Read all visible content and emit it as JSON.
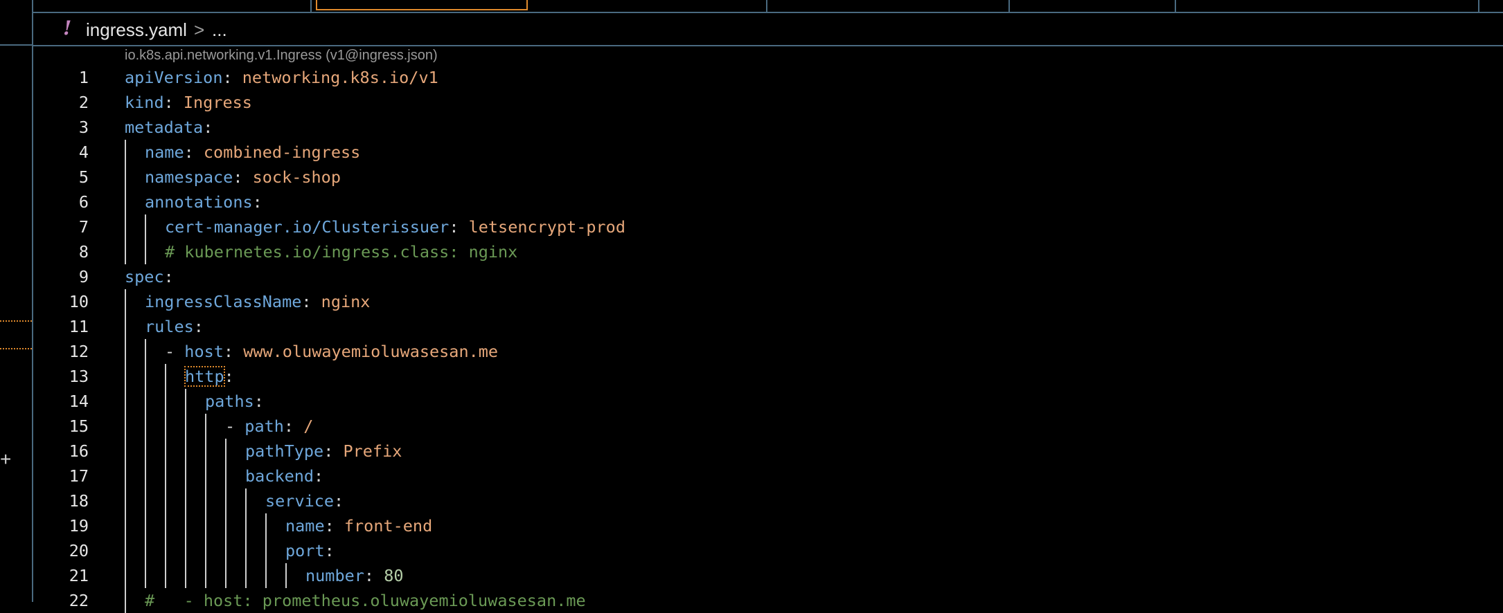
{
  "breadcrumb": {
    "icon": "!",
    "file_name": "ingress.yaml",
    "separator": ">",
    "ellipsis": "..."
  },
  "schema_hint": "io.k8s.api.networking.v1.Ingress (v1@ingress.json)",
  "left_strip": {
    "plus": "+"
  },
  "colors": {
    "key": "#6fa8dc",
    "string": "#e6a77a",
    "number": "#b5cea8",
    "comment": "#6a9955",
    "accent": "#e08a2c",
    "border": "#4a6a80"
  },
  "lines": [
    {
      "num": "1",
      "indent": 0,
      "key": "apiVersion",
      "sep": ": ",
      "value": "networking.k8s.io/v1",
      "vtype": "str"
    },
    {
      "num": "2",
      "indent": 0,
      "key": "kind",
      "sep": ": ",
      "value": "Ingress",
      "vtype": "str"
    },
    {
      "num": "3",
      "indent": 0,
      "key": "metadata",
      "sep": ":"
    },
    {
      "num": "4",
      "indent": 1,
      "key": "name",
      "sep": ": ",
      "value": "combined-ingress",
      "vtype": "str"
    },
    {
      "num": "5",
      "indent": 1,
      "key": "namespace",
      "sep": ": ",
      "value": "sock-shop",
      "vtype": "str"
    },
    {
      "num": "6",
      "indent": 1,
      "key": "annotations",
      "sep": ":"
    },
    {
      "num": "7",
      "indent": 2,
      "key": "cert-manager.io/Clusterissuer",
      "sep": ": ",
      "value": "letsencrypt-prod",
      "vtype": "str"
    },
    {
      "num": "8",
      "indent": 2,
      "comment": "# kubernetes.io/ingress.class: nginx"
    },
    {
      "num": "9",
      "indent": 0,
      "key": "spec",
      "sep": ":"
    },
    {
      "num": "10",
      "indent": 1,
      "key": "ingressClassName",
      "sep": ": ",
      "value": "nginx",
      "vtype": "str"
    },
    {
      "num": "11",
      "indent": 1,
      "key": "rules",
      "sep": ":"
    },
    {
      "num": "12",
      "indent": 2,
      "dash": "- ",
      "key": "host",
      "sep": ": ",
      "value": "www.oluwayemioluwasesan.me",
      "vtype": "str"
    },
    {
      "num": "13",
      "indent": 3,
      "key": "http",
      "sep": ":",
      "highlight": true
    },
    {
      "num": "14",
      "indent": 4,
      "key": "paths",
      "sep": ":"
    },
    {
      "num": "15",
      "indent": 5,
      "dash": "- ",
      "key": "path",
      "sep": ": ",
      "value": "/",
      "vtype": "str"
    },
    {
      "num": "16",
      "indent": 6,
      "key": "pathType",
      "sep": ": ",
      "value": "Prefix",
      "vtype": "str"
    },
    {
      "num": "17",
      "indent": 6,
      "key": "backend",
      "sep": ":"
    },
    {
      "num": "18",
      "indent": 7,
      "key": "service",
      "sep": ":"
    },
    {
      "num": "19",
      "indent": 8,
      "key": "name",
      "sep": ": ",
      "value": "front-end",
      "vtype": "str"
    },
    {
      "num": "20",
      "indent": 8,
      "key": "port",
      "sep": ":"
    },
    {
      "num": "21",
      "indent": 9,
      "key": "number",
      "sep": ": ",
      "value": "80",
      "vtype": "num"
    },
    {
      "num": "22",
      "indent": 1,
      "comment": "#   - host: prometheus.oluwayemioluwasesan.me"
    }
  ]
}
